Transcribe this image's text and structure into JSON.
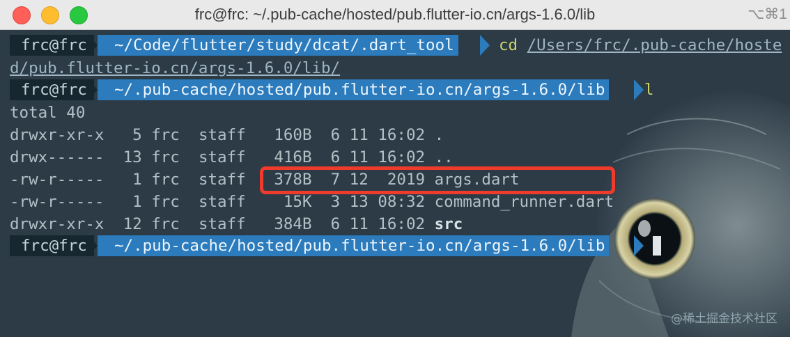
{
  "window": {
    "title": "frc@frc: ~/.pub-cache/hosted/pub.flutter-io.cn/args-1.6.0/lib",
    "shortcut": "⌥⌘1"
  },
  "terminal": {
    "prompt_user": "frc@frc",
    "prompt1_path": "~/Code/flutter/study/dcat/.dart_tool",
    "prompt1_cmd": "cd",
    "prompt1_arg_a": "/Users/frc/.pub-cache/hoste",
    "prompt1_arg_b": "d/pub.flutter-io.cn/args-1.6.0/lib/",
    "prompt2_path": "~/.pub-cache/hosted/pub.flutter-io.cn/args-1.6.0/lib",
    "prompt2_cmd": "l",
    "total": "total 40",
    "listing": [
      {
        "perm": "drwxr-xr-x",
        "links": "5",
        "owner": "frc",
        "group": "staff",
        "size": "160B",
        "date": "6 11 16:02",
        "name": "."
      },
      {
        "perm": "drwx------",
        "links": "13",
        "owner": "frc",
        "group": "staff",
        "size": "416B",
        "date": "6 11 16:02",
        "name": ".."
      },
      {
        "perm": "-rw-r-----",
        "links": "1",
        "owner": "frc",
        "group": "staff",
        "size": "378B",
        "date": "7 12  2019",
        "name": "args.dart"
      },
      {
        "perm": "-rw-r-----",
        "links": "1",
        "owner": "frc",
        "group": "staff",
        "size": "15K",
        "date": "3 13 08:32",
        "name": "command_runner.dart"
      },
      {
        "perm": "drwxr-xr-x",
        "links": "12",
        "owner": "frc",
        "group": "staff",
        "size": "384B",
        "date": "6 11 16:02",
        "name": "src"
      }
    ],
    "prompt3_path": "~/.pub-cache/hosted/pub.flutter-io.cn/args-1.6.0/lib"
  },
  "watermark": "@稀土掘金技术社区",
  "colors": {
    "prompt_user_bg": "#16272f",
    "prompt_path_bg": "#2b7bbd",
    "command": "#cbd36a",
    "highlight_box": "#ee3b2b"
  }
}
